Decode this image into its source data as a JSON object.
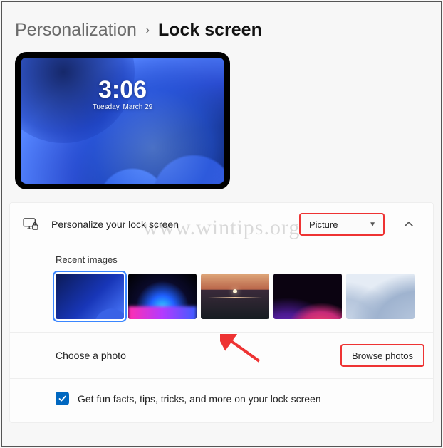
{
  "breadcrumb": {
    "parent": "Personalization",
    "current": "Lock screen"
  },
  "preview": {
    "time": "3:06",
    "date": "Tuesday, March 29"
  },
  "setting": {
    "title": "Personalize your lock screen",
    "dropdown_value": "Picture",
    "recent_label": "Recent images",
    "choose_label": "Choose a photo",
    "browse_label": "Browse photos",
    "fun_facts_label": "Get fun facts, tips, tricks, and more on your lock screen"
  },
  "watermark": "www.wintips.org"
}
